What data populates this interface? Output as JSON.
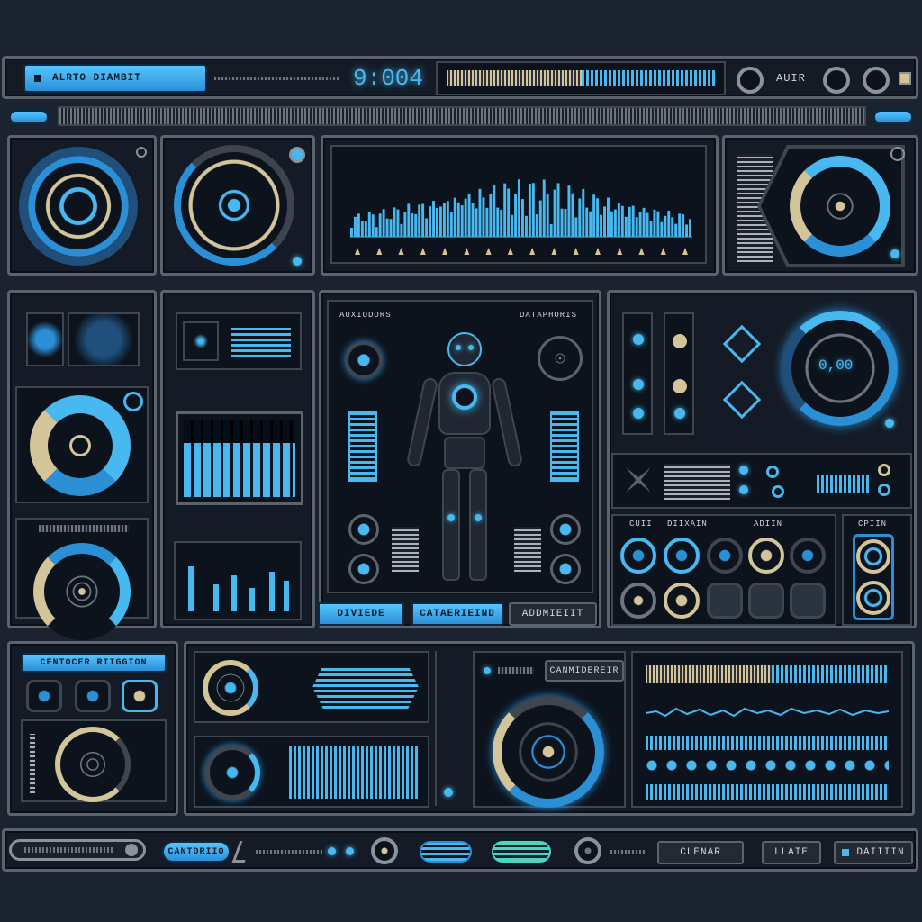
{
  "header": {
    "title": "ALRTO DIAMBIT",
    "clock": "9:004",
    "mode_label": "AUIR"
  },
  "central": {
    "titles": [
      "AUXIODORS",
      "DATAPHORIS"
    ],
    "buttons": [
      "DIVIEDE",
      "CATAERIEIND",
      "ADDMIEIIT"
    ]
  },
  "dial": {
    "readout": "0,00"
  },
  "right_mid": {
    "labels": [
      "CUII",
      "DIIXAIN",
      "ADIIN",
      "CPIIN"
    ]
  },
  "bottom_left": {
    "title": "CENTOCER RIIGGION"
  },
  "bottom_center": {
    "pill_label": "CANMIDEREIR"
  },
  "footer": {
    "button_label": "CANTDRIIO",
    "right_labels": [
      "CLENAR",
      "LLATE",
      "DAIIIIN"
    ]
  },
  "spectrum": {
    "type": "bar",
    "bars_count": 96,
    "ticks_count": 16
  },
  "colors": {
    "accent": "#48b8f0",
    "accent_dark": "#2b8fd6",
    "tan": "#d3c49a",
    "panel": "#141b26",
    "border": "#5b636d",
    "background": "#1b2230"
  }
}
